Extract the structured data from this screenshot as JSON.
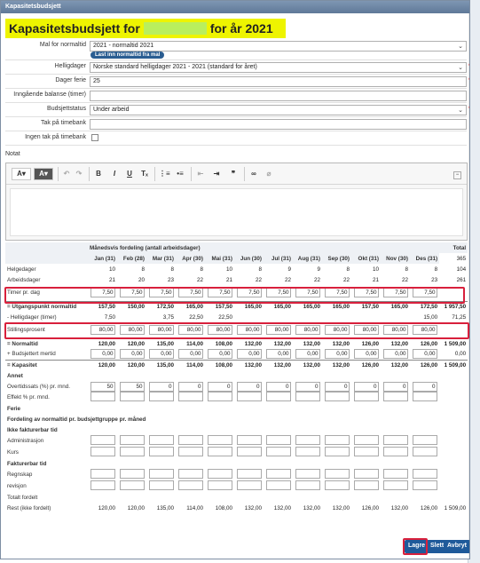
{
  "window": {
    "title": "Kapasitetsbudsjett"
  },
  "heading": {
    "prefix": "Kapasitetsbudsjett for",
    "suffix": "for år 2021"
  },
  "form": {
    "mal_label": "Mal for normaltid",
    "mal_value": "2021 - normaltid 2021",
    "last_inn_button": "Last inn normaltid fra mal",
    "helligdager_label": "Helligdager",
    "helligdager_value": "Norske standard helligdager 2021 - 2021 (standard for året)",
    "dager_ferie_label": "Dager ferie",
    "dager_ferie_value": "25",
    "inngaende_label": "Inngående balanse (timer)",
    "inngaende_value": "",
    "budsjettstatus_label": "Budsjettstatus",
    "budsjettstatus_value": "Under arbeid",
    "tak_label": "Tak på timebank",
    "tak_value": "",
    "ingen_tak_label": "Ingen tak på timebank",
    "notat_label": "Notat"
  },
  "table": {
    "header_title": "Månedsvis fordeling (antall arbeidsdager)",
    "total_header": "Total",
    "months": [
      "Jan (31)",
      "Feb (28)",
      "Mar (31)",
      "Apr (30)",
      "Mai (31)",
      "Jun (30)",
      "Jul (31)",
      "Aug (31)",
      "Sep (30)",
      "Okt (31)",
      "Nov (30)",
      "Des (31)"
    ],
    "total_days": "365",
    "rows": {
      "helgedager": {
        "label": "Helgedager",
        "values": [
          "10",
          "8",
          "8",
          "8",
          "10",
          "8",
          "9",
          "9",
          "8",
          "10",
          "8",
          "8"
        ],
        "total": "104"
      },
      "arbeidsdager": {
        "label": "Arbeidsdager",
        "values": [
          "21",
          "20",
          "23",
          "22",
          "21",
          "22",
          "22",
          "22",
          "22",
          "21",
          "22",
          "23"
        ],
        "total": "261"
      },
      "timer_pr_dag": {
        "label": "Timer pr. dag",
        "values": [
          "7,50",
          "7,50",
          "7,50",
          "7,50",
          "7,50",
          "7,50",
          "7,50",
          "7,50",
          "7,50",
          "7,50",
          "7,50",
          "7,50"
        ],
        "total": ""
      },
      "utgangspunkt": {
        "label": "= Utgangspunkt normaltid",
        "values": [
          "157,50",
          "150,00",
          "172,50",
          "165,00",
          "157,50",
          "165,00",
          "165,00",
          "165,00",
          "165,00",
          "157,50",
          "165,00",
          "172,50"
        ],
        "total": "1 957,50"
      },
      "helligdager_timer": {
        "label": "- Helligdager (timer)",
        "values": [
          "7,50",
          "",
          "3,75",
          "22,50",
          "22,50",
          "",
          "",
          "",
          "",
          "",
          "",
          "15,00"
        ],
        "total": "71,25"
      },
      "stillingsprosent": {
        "label": "Stillingsprosent",
        "values": [
          "80,00",
          "80,00",
          "80,00",
          "80,00",
          "80,00",
          "80,00",
          "80,00",
          "80,00",
          "80,00",
          "80,00",
          "80,00",
          "80,00"
        ],
        "total": ""
      },
      "normaltid": {
        "label": "= Normaltid",
        "values": [
          "120,00",
          "120,00",
          "135,00",
          "114,00",
          "108,00",
          "132,00",
          "132,00",
          "132,00",
          "132,00",
          "126,00",
          "132,00",
          "126,00"
        ],
        "total": "1 509,00"
      },
      "budsjettert_mertid": {
        "label": "+ Budsjettert mertid",
        "values": [
          "0,00",
          "0,00",
          "0,00",
          "0,00",
          "0,00",
          "0,00",
          "0,00",
          "0,00",
          "0,00",
          "0,00",
          "0,00",
          "0,00"
        ],
        "total": "0,00"
      },
      "kapasitet": {
        "label": "= Kapasitet",
        "values": [
          "120,00",
          "120,00",
          "135,00",
          "114,00",
          "108,00",
          "132,00",
          "132,00",
          "132,00",
          "132,00",
          "126,00",
          "132,00",
          "126,00"
        ],
        "total": "1 509,00"
      },
      "overtidssats": {
        "label": "Overtidssats (%) pr. mnd.",
        "values": [
          "50",
          "50",
          "0",
          "0",
          "0",
          "0",
          "0",
          "0",
          "0",
          "0",
          "0",
          "0"
        ]
      },
      "effekt": {
        "label": "Effekt % pr. mnd."
      },
      "rest": {
        "label": "Rest (ikke fordelt)",
        "values": [
          "120,00",
          "120,00",
          "135,00",
          "114,00",
          "108,00",
          "132,00",
          "132,00",
          "132,00",
          "132,00",
          "126,00",
          "132,00",
          "126,00"
        ],
        "total": "1 509,00"
      }
    },
    "annet_label": "Annet",
    "ferie_label": "Ferie",
    "fordeling_label": "Fordeling av normaltid pr. budsjettgruppe pr. måned",
    "ikke_fakturerbar_label": "Ikke fakturerbar tid",
    "administrasjon_label": "Administrasjon",
    "kurs_label": "Kurs",
    "fakturerbar_label": "Fakturerbar tid",
    "regnskap_label": "Regnskap",
    "revisjon_label": "revisjon",
    "totalt_fordelt_label": "Totalt fordelt"
  },
  "buttons": {
    "lagre": "Lagre",
    "slett": "Slett",
    "avbryt": "Avbryt"
  },
  "colors": {
    "heading_bg": "#eef400",
    "highlight": "#d8203c",
    "button": "#1f5a9a"
  }
}
